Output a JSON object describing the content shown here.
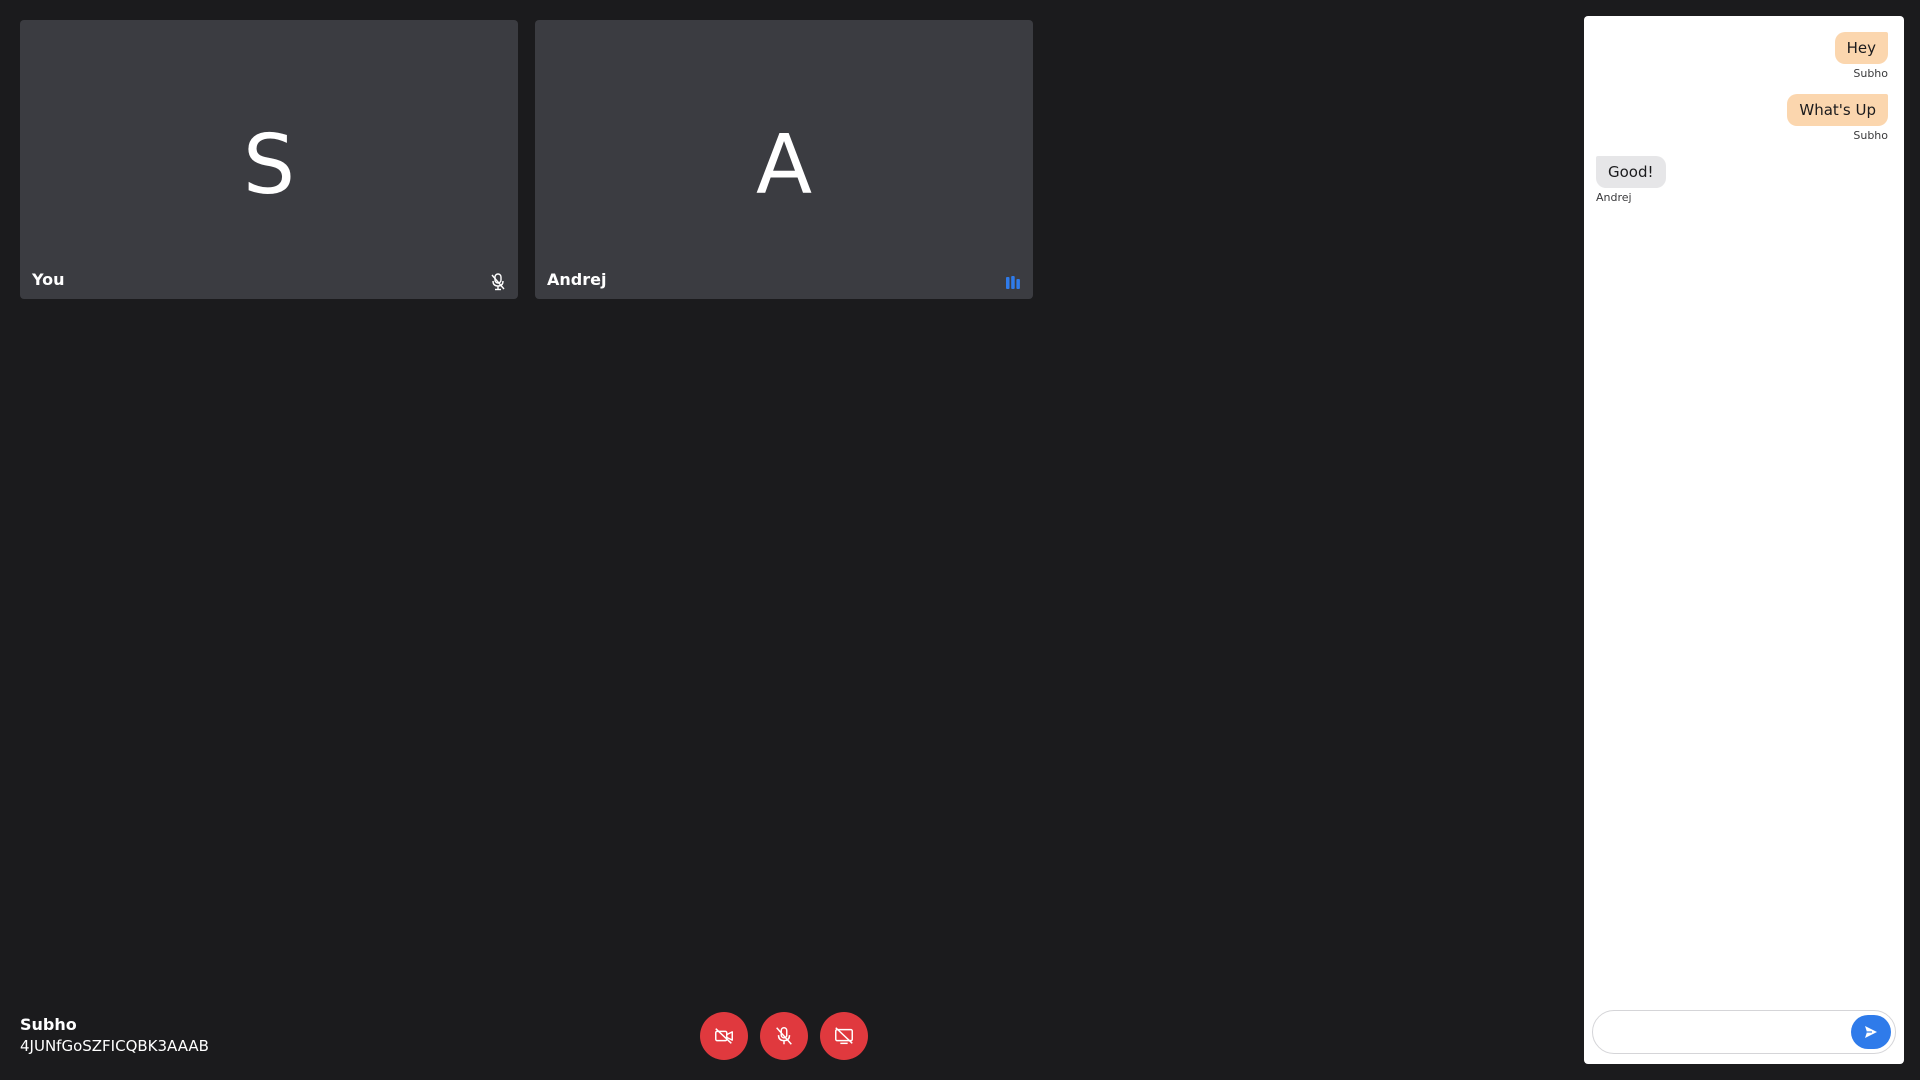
{
  "tiles": [
    {
      "initial": "S",
      "name": "You",
      "status_icon": "mic-off-icon"
    },
    {
      "initial": "A",
      "name": "Andrej",
      "status_icon": "audio-level-icon"
    }
  ],
  "meeting": {
    "user_name": "Subho",
    "meeting_id": "4JUNfGoSZFICQBK3AAAB"
  },
  "controls": [
    {
      "icon": "video-off-icon"
    },
    {
      "icon": "mic-off-icon"
    },
    {
      "icon": "screen-share-off-icon"
    }
  ],
  "chat": {
    "messages": [
      {
        "text": "Hey",
        "sender": "Subho",
        "direction": "outgoing"
      },
      {
        "text": "What's Up",
        "sender": "Subho",
        "direction": "outgoing"
      },
      {
        "text": "Good!",
        "sender": "Andrej",
        "direction": "incoming"
      }
    ],
    "input_value": "",
    "send_icon": "send-icon"
  },
  "colors": {
    "background": "#1b1b1d",
    "tile": "#3b3c41",
    "control_red": "#e0393e",
    "outgoing_bubble": "#fbd6ae",
    "incoming_bubble": "#e6e6e8",
    "accent_blue": "#2f7bea"
  }
}
